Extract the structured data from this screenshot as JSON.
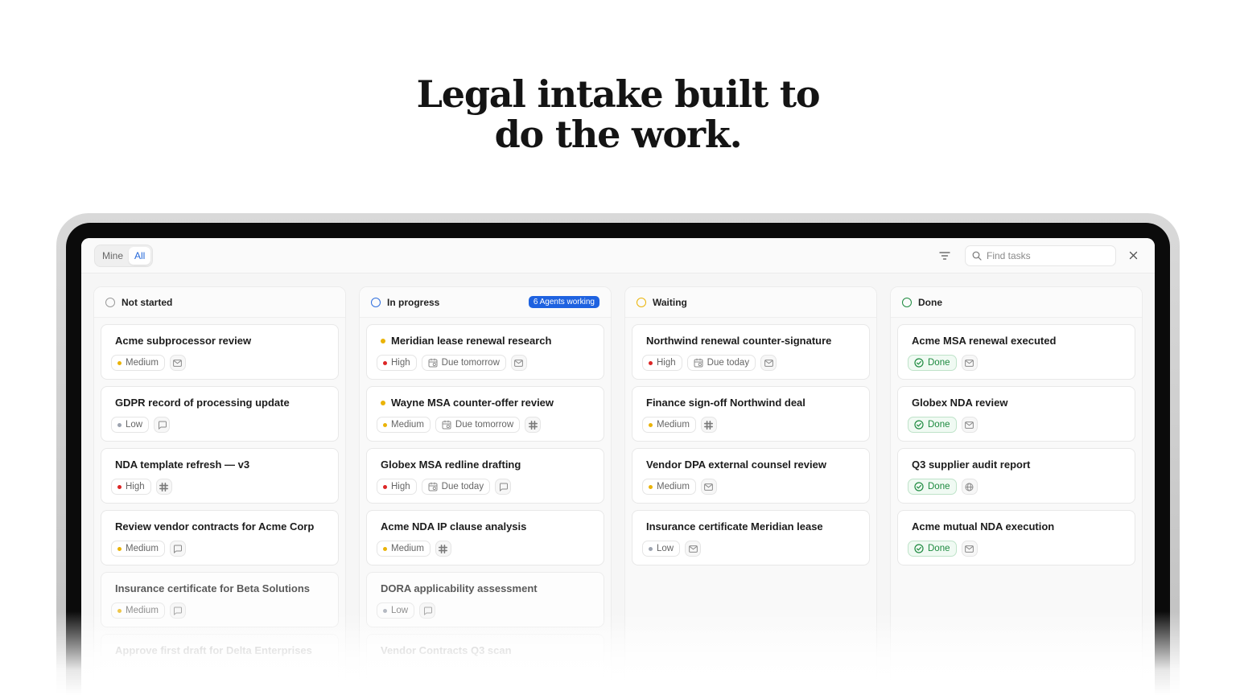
{
  "headline": {
    "line1": "Legal intake built to",
    "line2": "do the work."
  },
  "toolbar": {
    "toggle": {
      "mine_label": "Mine",
      "all_label": "All",
      "selected": "All"
    },
    "search_placeholder": "Find tasks",
    "icons": {
      "filter": "filter-icon",
      "search": "search-icon",
      "close": "close-icon"
    }
  },
  "colors": {
    "accent": "#1e62e0",
    "priority_high": "#dc2626",
    "priority_medium": "#eab308",
    "priority_low": "#9ca3af",
    "done": "#1d8a3f",
    "status_not_started": "#9a9a9a",
    "status_in_progress": "#2f6fde",
    "status_waiting": "#eab308",
    "status_done": "#1d8a3f"
  },
  "columns": [
    {
      "title": "Not started",
      "status": "not_started",
      "badge": "",
      "cards": [
        {
          "title": "Acme subprocessor review",
          "priority": "Medium",
          "due": "",
          "source": "mail-icon",
          "running": false
        },
        {
          "title": "GDPR record of processing update",
          "priority": "Low",
          "due": "",
          "source": "chat-icon",
          "running": false
        },
        {
          "title": "NDA template refresh — v3",
          "priority": "High",
          "due": "",
          "source": "slack-icon",
          "running": false
        },
        {
          "title": "Review vendor contracts for Acme Corp",
          "priority": "Medium",
          "due": "",
          "source": "chat-icon",
          "running": false
        },
        {
          "title": "Insurance certificate for Beta Solutions",
          "priority": "Medium",
          "due": "",
          "source": "chat-icon",
          "running": false
        },
        {
          "title": "Approve first draft for Delta Enterprises",
          "priority": "",
          "due": "",
          "source": "",
          "running": false
        }
      ]
    },
    {
      "title": "In progress",
      "status": "in_progress",
      "badge": "6 Agents working",
      "cards": [
        {
          "title": "Meridian lease renewal research",
          "priority": "High",
          "due": "Due tomorrow",
          "source": "mail-icon",
          "running": true
        },
        {
          "title": "Wayne MSA counter-offer review",
          "priority": "Medium",
          "due": "Due tomorrow",
          "source": "slack-icon",
          "running": true
        },
        {
          "title": "Globex MSA redline drafting",
          "priority": "High",
          "due": "Due today",
          "source": "chat-icon",
          "running": false
        },
        {
          "title": "Acme NDA IP clause analysis",
          "priority": "Medium",
          "due": "",
          "source": "slack-icon",
          "running": false
        },
        {
          "title": "DORA applicability assessment",
          "priority": "Low",
          "due": "",
          "source": "chat-icon",
          "running": false
        },
        {
          "title": "Vendor Contracts Q3 scan",
          "priority": "",
          "due": "",
          "source": "",
          "running": false
        }
      ]
    },
    {
      "title": "Waiting",
      "status": "waiting",
      "badge": "",
      "cards": [
        {
          "title": "Northwind renewal counter-signature",
          "priority": "High",
          "due": "Due today",
          "source": "mail-icon",
          "running": false
        },
        {
          "title": "Finance sign-off Northwind deal",
          "priority": "Medium",
          "due": "",
          "source": "slack-icon",
          "running": false
        },
        {
          "title": "Vendor DPA external counsel review",
          "priority": "Medium",
          "due": "",
          "source": "mail-icon",
          "running": false
        },
        {
          "title": "Insurance certificate Meridian lease",
          "priority": "Low",
          "due": "",
          "source": "mail-icon",
          "running": false
        }
      ]
    },
    {
      "title": "Done",
      "status": "done",
      "badge": "",
      "cards": [
        {
          "title": "Acme MSA renewal executed",
          "priority": "",
          "done_label": "Done",
          "due": "",
          "source": "mail-icon",
          "running": false
        },
        {
          "title": "Globex NDA review",
          "priority": "",
          "done_label": "Done",
          "due": "",
          "source": "mail-icon",
          "running": false
        },
        {
          "title": "Q3 supplier audit report",
          "priority": "",
          "done_label": "Done",
          "due": "",
          "source": "globe-icon",
          "running": false
        },
        {
          "title": "Acme mutual NDA execution",
          "priority": "",
          "done_label": "Done",
          "due": "",
          "source": "mail-icon",
          "running": false
        }
      ]
    }
  ]
}
